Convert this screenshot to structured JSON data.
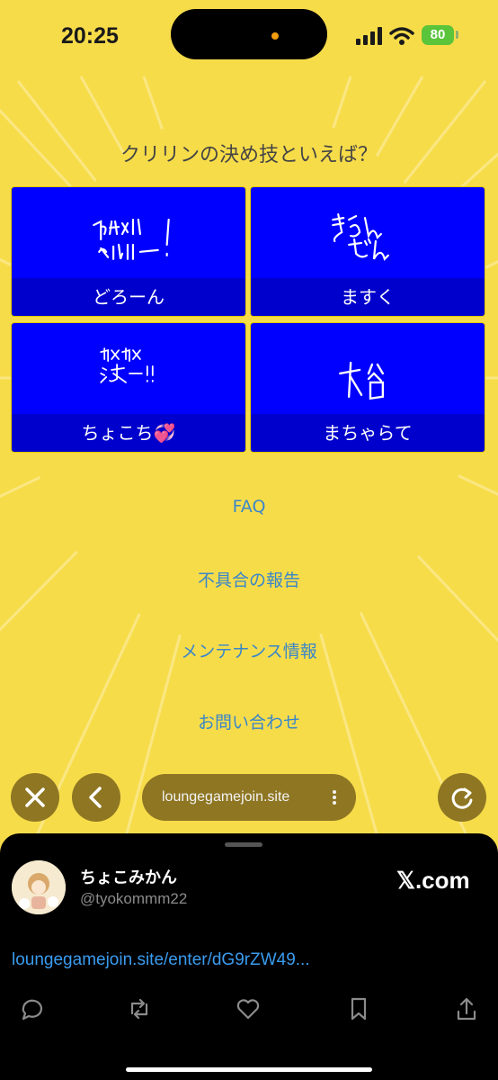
{
  "status_bar": {
    "time": "20:25",
    "battery": "80"
  },
  "quiz": {
    "question": "クリリンの決め技といえば？",
    "options": [
      {
        "label": "どろーん"
      },
      {
        "label": "ますく"
      },
      {
        "label": "ちょこち💞"
      },
      {
        "label": "まちゃらて"
      }
    ]
  },
  "links": {
    "faq": "FAQ",
    "bug_report": "不具合の報告",
    "maintenance": "メンテナンス情報",
    "contact": "お問い合わせ"
  },
  "browser_toolbar": {
    "url": "loungegamejoin.site"
  },
  "share_sheet": {
    "username": "ちょこみかん",
    "handle": "@tyokommm22",
    "site": "𝕏.com",
    "link": "loungegamejoin.site/enter/dG9rZW49..."
  },
  "colors": {
    "background": "#f7dc4a",
    "option_bg": "#0000ff",
    "option_label_bg": "#0000cc",
    "link": "#3a86c8"
  }
}
